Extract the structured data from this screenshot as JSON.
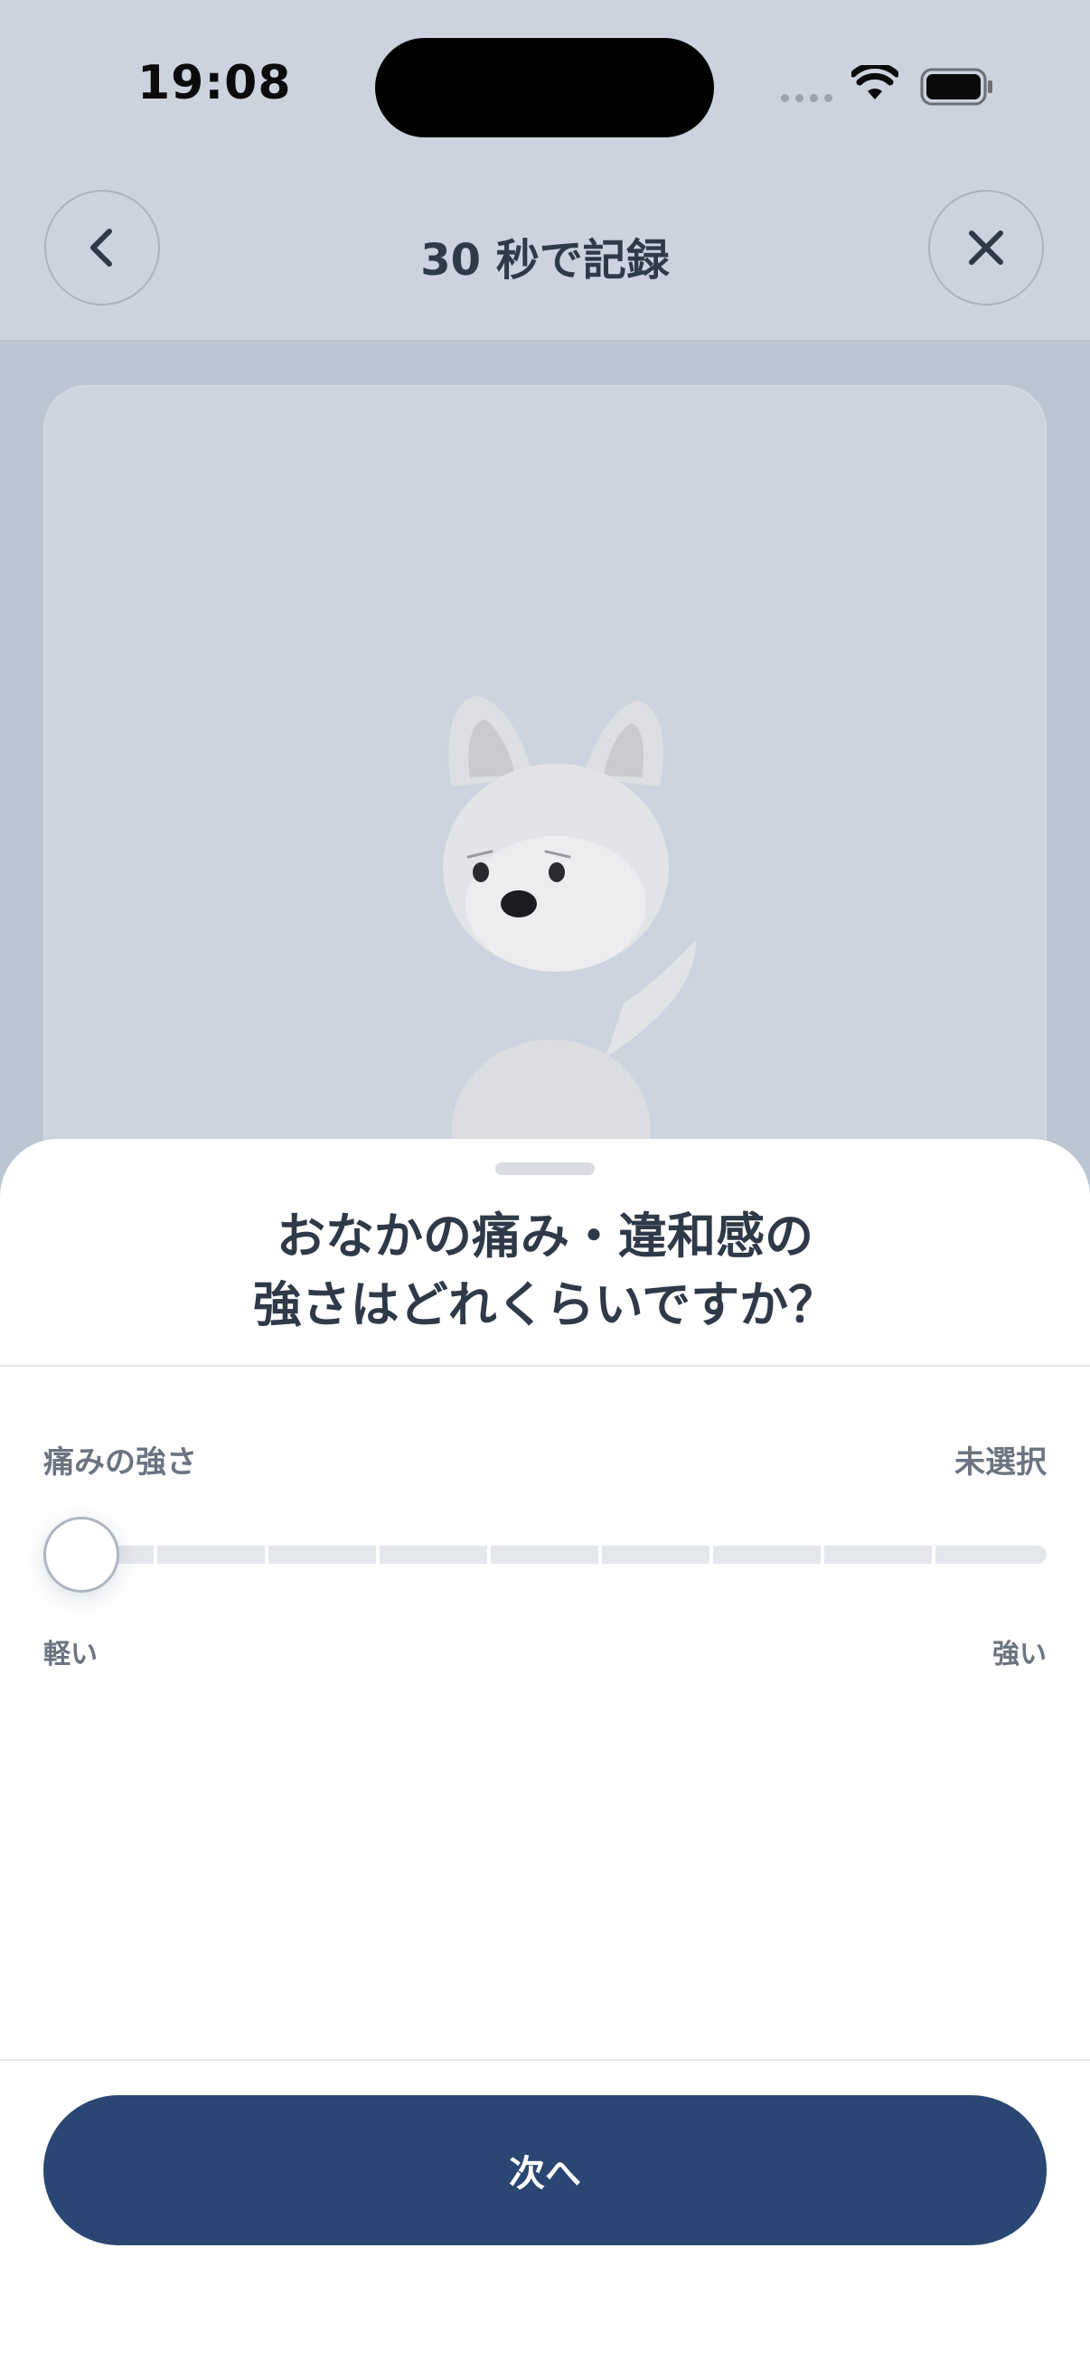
{
  "status_bar": {
    "time": "19:08"
  },
  "nav": {
    "title": "30 秒で記録"
  },
  "sheet": {
    "question_line1": "おなかの痛み・違和感の",
    "question_line2": "強さはどれくらいですか？",
    "slider": {
      "label": "痛みの強さ",
      "status": "未選択",
      "min_label": "軽い",
      "max_label": "強い",
      "value": null
    },
    "next_button": "次へ"
  },
  "colors": {
    "background": "#ccd3df",
    "accent": "#2a4672",
    "sheet": "#ffffff"
  },
  "icons": {
    "back": "chevron-left-icon",
    "close": "close-icon",
    "wifi": "wifi-icon",
    "battery": "battery-icon"
  }
}
